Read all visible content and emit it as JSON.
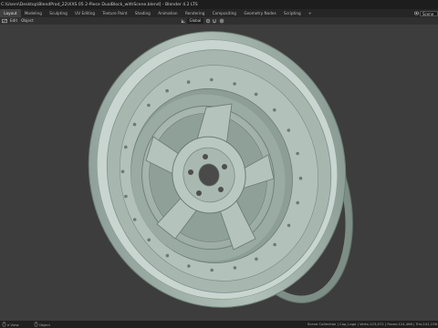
{
  "window": {
    "title": "C:\\Users\\Desktop\\BlendProd_22\\XXS 05 2-Piece DualBlock_withScene.blend] - Blender 4.2 LTS"
  },
  "workspaces": [
    "Layout",
    "Modeling",
    "Sculpting",
    "UV Editing",
    "Texture Paint",
    "Shading",
    "Animation",
    "Rendering",
    "Compositing",
    "Geometry Nodes",
    "Scripting",
    "+"
  ],
  "active_workspace": "Layout",
  "scene": {
    "label": "Scene"
  },
  "header": {
    "menus": [
      "Edit",
      "Object"
    ],
    "orientation": "Global"
  },
  "status_bar": {
    "left_items": [
      "e View",
      "Object"
    ],
    "right": "Scene Collection | Cap_Logo | Verts:123,072 | Faces:124,466 | Tris:241,136"
  },
  "colors": {
    "viewport_bg": "#3d3d3d",
    "wheel_face": "#a9b9b2",
    "wheel_shadow": "#7e8f87",
    "wheel_highlight": "#c6d2cd",
    "accent": "#4772b3"
  },
  "icons": [
    "blender-logo-icon",
    "scene-icon",
    "editor-type-icon",
    "transform-orientation-icon",
    "pivot-icon",
    "snap-icon",
    "proportional-icon",
    "mouse-icon"
  ]
}
